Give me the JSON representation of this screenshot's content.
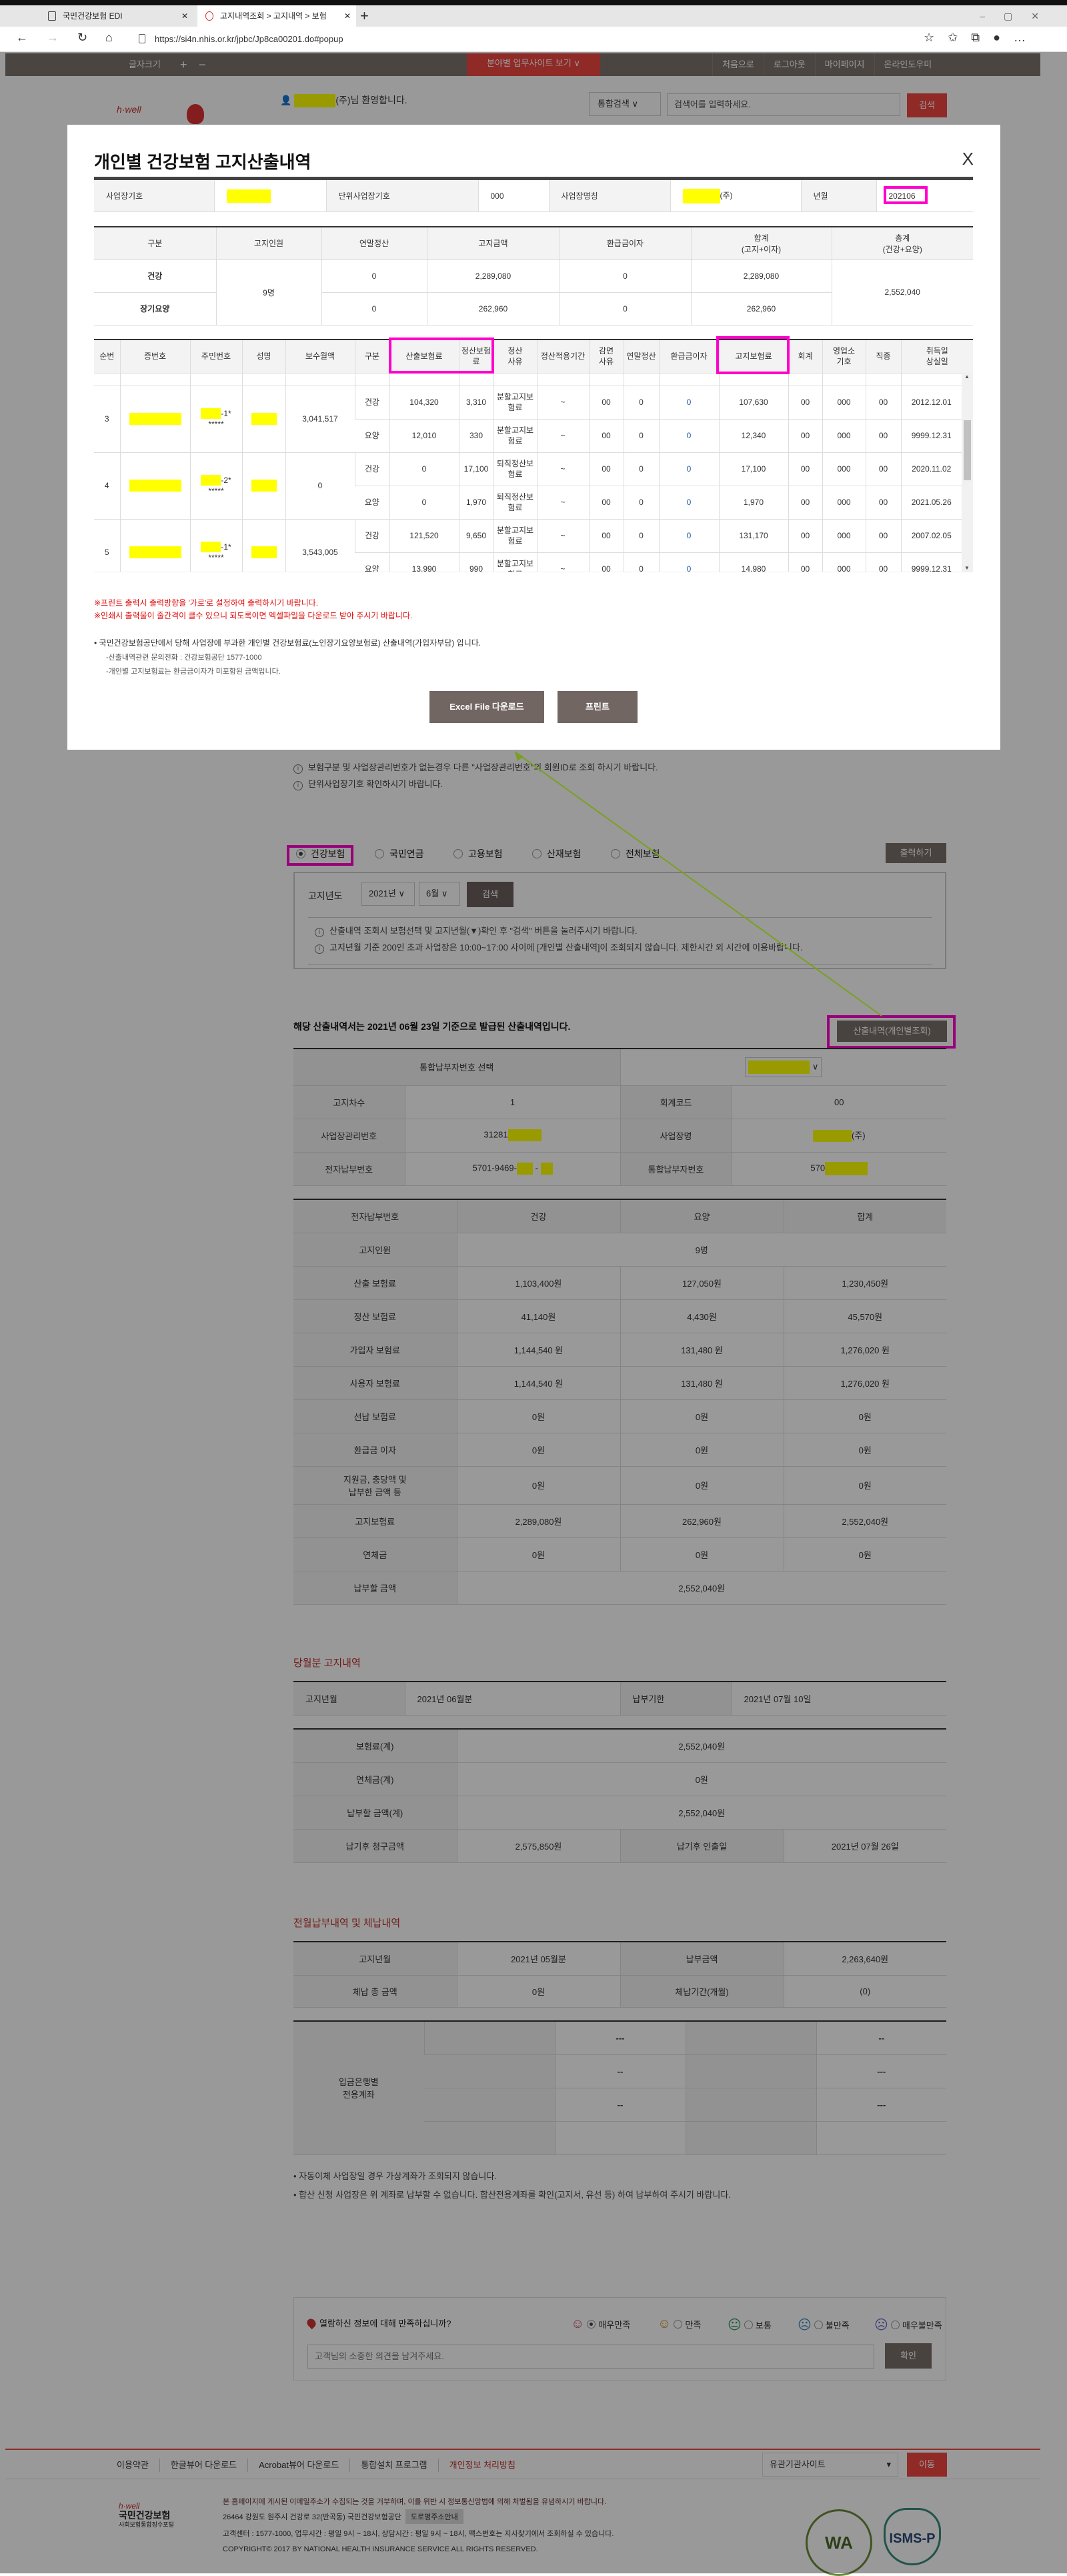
{
  "browser": {
    "tabs": [
      {
        "label": "국민건강보험 EDI"
      },
      {
        "label": "고지내역조회 > 고지내역 > 보험"
      }
    ],
    "url": "https://si4n.nhis.or.kr/jpbc/Jp8ca00201.do#popup"
  },
  "site_header": {
    "font_size_label": "글자크기",
    "plus": "+",
    "minus": "−",
    "center_button": "분야별 업무사이트 보기 ∨",
    "nav": [
      "처음으로",
      "로그아웃",
      "마이페이지",
      "온라인도우미"
    ],
    "welcome": "(주)님 환영합니다.",
    "search_select": "통합검색",
    "search_placeholder": "검색어를 입력하세요.",
    "search_button": "검색",
    "logo_text": "h·well"
  },
  "modal": {
    "title": "개인별 건강보험 고지산출내역",
    "close": "X",
    "info": [
      {
        "label": "사업장기호",
        "value": ""
      },
      {
        "label": "단위사업장기호",
        "value": "000"
      },
      {
        "label": "사업장명칭",
        "value": "(주)"
      },
      {
        "label": "년월",
        "value": "202106"
      }
    ],
    "summary": {
      "headers": [
        "구분",
        "고지인원",
        "연말정산",
        "고지금액",
        "환급금이자",
        "합계\n(고지+이자)",
        "총계\n(건강+요양)"
      ],
      "headcount": "9명",
      "grand_total": "2,552,040",
      "rows": [
        {
          "type": "건강",
          "yearend": "0",
          "notice": "2,289,080",
          "refund": "0",
          "total": "2,289,080"
        },
        {
          "type": "장기요양",
          "yearend": "0",
          "notice": "262,960",
          "refund": "0",
          "total": "262,960"
        }
      ]
    },
    "detail": {
      "headers": [
        "순번",
        "증번호",
        "주민번호",
        "성명",
        "보수월액",
        "구분",
        "산출보험료",
        "정산보험\n료",
        "정산\n사유",
        "정산적용기간",
        "감면\n사유",
        "연말정산",
        "환급금이자",
        "고지보험료",
        "회계",
        "영업소\n기호",
        "직종",
        "취득일\n상실일"
      ],
      "rows": [
        {
          "no": "3",
          "rrn_suffix": "-1*",
          "rrn_mask": "*****",
          "wage": "3,041,517",
          "lines": [
            [
              "건강",
              "104,320",
              "3,310",
              "분할고지보험료",
              "~",
              "00",
              "0",
              "0",
              "107,630",
              "00",
              "000",
              "00",
              "2012.12.01"
            ],
            [
              "요양",
              "12,010",
              "330",
              "분할고지보험료",
              "~",
              "00",
              "0",
              "0",
              "12,340",
              "00",
              "000",
              "00",
              "9999.12.31"
            ]
          ]
        },
        {
          "no": "4",
          "rrn_suffix": "-2*",
          "rrn_mask": "*****",
          "wage": "0",
          "lines": [
            [
              "건강",
              "0",
              "17,100",
              "퇴직정산보험료",
              "~",
              "00",
              "0",
              "0",
              "17,100",
              "00",
              "000",
              "00",
              "2020.11.02"
            ],
            [
              "요양",
              "0",
              "1,970",
              "퇴직정산보험료",
              "~",
              "00",
              "0",
              "0",
              "1,970",
              "00",
              "000",
              "00",
              "2021.05.26"
            ]
          ]
        },
        {
          "no": "5",
          "rrn_suffix": "-1*",
          "rrn_mask": "*****",
          "wage": "3,543,005",
          "lines": [
            [
              "건강",
              "121,520",
              "9,650",
              "분할고지보험료",
              "~",
              "00",
              "0",
              "0",
              "131,170",
              "00",
              "000",
              "00",
              "2007.02.05"
            ],
            [
              "요양",
              "13,990",
              "990",
              "분할고지보험료",
              "~",
              "00",
              "0",
              "0",
              "14,980",
              "00",
              "000",
              "00",
              "9999.12.31"
            ]
          ]
        }
      ]
    },
    "warnings": [
      "※프린트 출력시 출력방향을 '가로'로 설정하여 출력하시기 바랍니다.",
      "※인쇄시 출력물이 줄간격이 클수 있으니 되도록이면 엑셀파일을 다운로드 받아 주시기 바랍니다."
    ],
    "note": "• 국민건강보험공단에서 당해 사업장에 부과한 개인별 건강보험료(노인장기요양보험료) 산출내역(가입자부담) 입니다.",
    "subnotes": [
      "-산출내역관련 문의전화 : 건강보험공단 1577-1000",
      "-개인별 고지보험료는 환급금이자가 미포함된 금액입니다."
    ],
    "excel_button": "Excel File 다운로드",
    "print_button": "프린트"
  },
  "page": {
    "notes": [
      "보험구분 및 사업장관리번호가 없는경우 다른 \"사업장관리번호\"의 회원ID로 조회 하시기 바랍니다.",
      "단위사업장기호 확인하시기 바랍니다."
    ],
    "insurance_types": [
      {
        "label": "건강보험",
        "selected": true
      },
      {
        "label": "국민연금",
        "selected": false
      },
      {
        "label": "고용보험",
        "selected": false
      },
      {
        "label": "산재보험",
        "selected": false
      },
      {
        "label": "전체보험",
        "selected": false
      }
    ],
    "print_button": "출력하기",
    "search": {
      "label": "고지년도",
      "year": "2021년",
      "month": "6월",
      "button": "검색",
      "infos": [
        "산출내역 조회시 보험선택 및 고지년월(▼)확인 후 \"검색\" 버튼을 눌러주시기 바랍니다.",
        "고지년월 기준 200인 초과 사업장은 10:00~17:00 사이에 [개인별 산출내역]이 조회되지 않습니다. 제한시간 외 시간에 이용바랍니다."
      ]
    },
    "basis_text": "해당 산출내역서는 2021년 06월 23일 기준으로 발급된 산출내역입니다.",
    "individual_button": "산출내역(개인별조회)",
    "payer_table": {
      "select_label": "통합납부자번호 선택",
      "rows": [
        [
          "고지차수",
          "1",
          "회계코드",
          "00"
        ],
        [
          "사업장관리번호",
          "31281",
          "사업장명",
          "(주)"
        ],
        [
          "전자납부번호",
          "5701-9469-",
          "통합납부자번호",
          "570"
        ]
      ]
    },
    "amount_table": {
      "headers": [
        "전자납부번호",
        "건강",
        "요양",
        "합계"
      ],
      "headcount_label": "고지인원",
      "headcount": "9명",
      "rows": [
        [
          "산출 보험료",
          "1,103,400원",
          "127,050원",
          "1,230,450원"
        ],
        [
          "정산 보험료",
          "41,140원",
          "4,430원",
          "45,570원"
        ],
        [
          "가입자 보험료",
          "1,144,540 원",
          "131,480 원",
          "1,276,020 원"
        ],
        [
          "사용자 보험료",
          "1,144,540 원",
          "131,480 원",
          "1,276,020 원"
        ],
        [
          "선납 보험료",
          "0원",
          "0원",
          "0원"
        ],
        [
          "환급금 이자",
          "0원",
          "0원",
          "0원"
        ],
        [
          "지원금, 충당액 및\n납부한 금액 등",
          "0원",
          "0원",
          "0원"
        ],
        [
          "고지보험료",
          "2,289,080원",
          "262,960원",
          "2,552,040원"
        ],
        [
          "연체금",
          "0원",
          "0원",
          "0원"
        ]
      ],
      "payable_label": "납부할 금액",
      "payable": "2,552,040원"
    },
    "current": {
      "title": "당월분 고지내역",
      "row": [
        "고지년월",
        "2021년 06월분",
        "납부기한",
        "2021년 07월 10일"
      ],
      "rows": [
        [
          "보험료(계)",
          "2,552,040원"
        ],
        [
          "연체금(계)",
          "0원"
        ],
        [
          "납부할 금액(계)",
          "2,552,040원"
        ]
      ],
      "late_row": [
        "납기후 청구금액",
        "2,575,850원",
        "납기후 인출일",
        "2021년 07월 26일"
      ]
    },
    "previous": {
      "title": "전월납부내역 및 체납내역",
      "rows": [
        [
          "고지년월",
          "2021년 05월분",
          "납부금액",
          "2,263,640원"
        ],
        [
          "체납 총 금액",
          "0원",
          "체납기간(개월)",
          "(0)"
        ]
      ],
      "account_label": "입금은행별\n전용계좌",
      "accounts": [
        [
          "",
          "---",
          "",
          "--"
        ],
        [
          "",
          "--",
          "",
          "---"
        ],
        [
          "",
          "--",
          "",
          "---"
        ],
        [
          "",
          "",
          "",
          ""
        ]
      ],
      "bullets": [
        "• 자동이체 사업장일 경우 가상계좌가 조회되지 않습니다.",
        "• 합산 신청 사업장은 위 계좌로 납부할 수 없습니다. 합산전용계좌를 확인(고지서, 유선 등) 하여 납부하여 주시기 바랍니다."
      ]
    },
    "survey": {
      "question": "열람하신 정보에 대해 만족하십니까?",
      "options": [
        {
          "label": "매우만족",
          "icon": "☺",
          "color": "#d0506a",
          "selected": true
        },
        {
          "label": "만족",
          "icon": "☺",
          "color": "#d08a20",
          "selected": false
        },
        {
          "label": "보통",
          "icon": "😐",
          "color": "#2a9a5a",
          "selected": false
        },
        {
          "label": "불만족",
          "icon": "☹",
          "color": "#3a8ac0",
          "selected": false
        },
        {
          "label": "매우불만족",
          "icon": "☹",
          "color": "#6a6ad0",
          "selected": false
        }
      ],
      "placeholder": "고객님의 소중한 의견을 남겨주세요.",
      "ok": "확인"
    }
  },
  "footer": {
    "links": [
      "이용약관",
      "한글뷰어 다운로드",
      "Acrobat뷰어 다운로드",
      "통합설치 프로그램",
      "개인정보 처리방침"
    ],
    "family_select": "유관기관사이트",
    "go": "이동",
    "info": [
      "본 홈페이지에 게시된 이메일주소가 수집되는 것을 거부하며, 이를 위반 시 정보통신망법에 의해 처벌됨을 유념하시기 바랍니다.",
      "26464 강원도 원주시 건강로 32(반곡동) 국민건강보험공단",
      "고객센터 : 1577-1000, 업무시간 : 평일 9시 ~ 18시, 상담시간 : 평일 9시 ~ 18시, 팩스번호는 지사찾기에서 조회하실 수 있습니다.",
      "COPYRIGHT© 2017 BY NATIONAL HEALTH INSURANCE SERVICE ALL RIGHTS RESERVED."
    ],
    "road_address_button": "도로명주소안내",
    "logo_lines": [
      "h·well",
      "국민건강보험",
      "사회보험통합징수포털"
    ],
    "badges": [
      "WA",
      "ISMS-P"
    ]
  }
}
